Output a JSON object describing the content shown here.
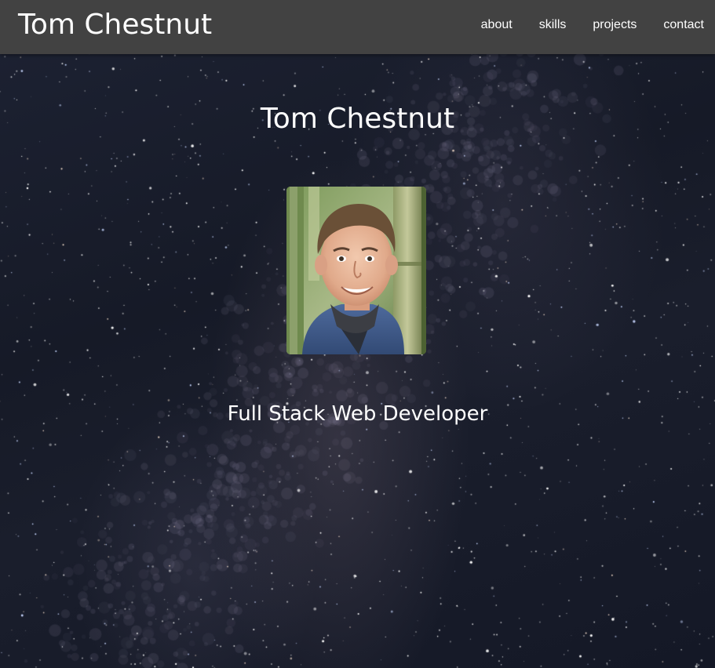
{
  "navbar": {
    "brand": "Tom Chestnut",
    "links": [
      {
        "label": "about"
      },
      {
        "label": "skills"
      },
      {
        "label": "projects"
      },
      {
        "label": "contact"
      }
    ]
  },
  "hero": {
    "title": "Tom Chestnut",
    "subtitle": "Full Stack Web Developer",
    "avatar_icon": "profile-photo"
  },
  "colors": {
    "navbar_bg": "#424242",
    "text": "#ffffff",
    "sky": "#161a27"
  }
}
